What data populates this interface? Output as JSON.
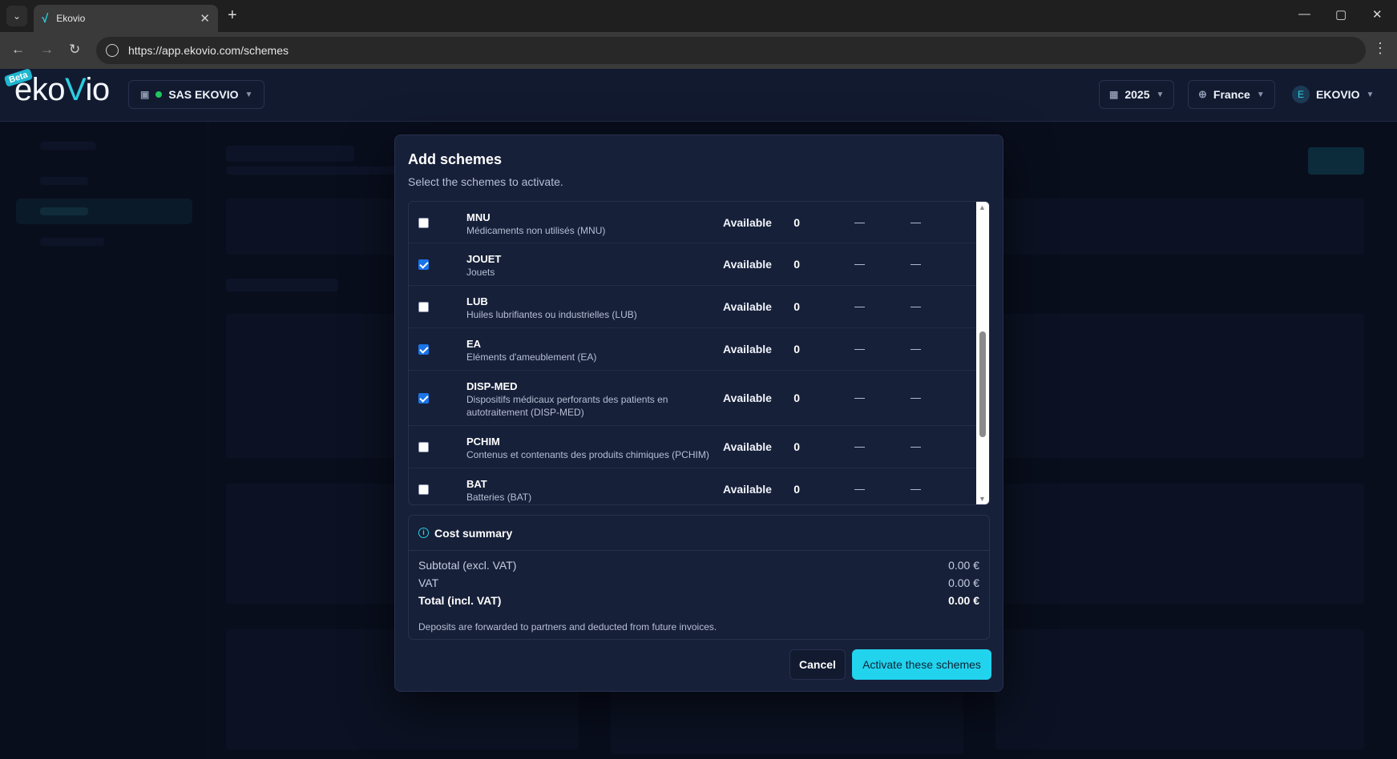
{
  "browser": {
    "tab_title": "Ekovio",
    "url": "https://app.ekovio.com/schemes"
  },
  "header": {
    "beta": "Beta",
    "logo_prefix": "eko",
    "logo_v": "V",
    "logo_suffix": "io",
    "org_name": "SAS EKOVIO",
    "year": "2025",
    "country": "France",
    "user_initial": "E",
    "user_name": "EKOVIO"
  },
  "modal": {
    "title": "Add schemes",
    "subtitle": "Select the schemes to activate.",
    "schemes": [
      {
        "code": "MNU",
        "desc": "Médicaments non utilisés (MNU)",
        "status": "Available",
        "qty": "0",
        "c1": "—",
        "c2": "—",
        "checked": false
      },
      {
        "code": "JOUET",
        "desc": "Jouets",
        "status": "Available",
        "qty": "0",
        "c1": "—",
        "c2": "—",
        "checked": true
      },
      {
        "code": "LUB",
        "desc": "Huiles lubrifiantes ou industrielles (LUB)",
        "status": "Available",
        "qty": "0",
        "c1": "—",
        "c2": "—",
        "checked": false
      },
      {
        "code": "EA",
        "desc": "Eléments d'ameublement (EA)",
        "status": "Available",
        "qty": "0",
        "c1": "—",
        "c2": "—",
        "checked": true
      },
      {
        "code": "DISP-MED",
        "desc": "Dispositifs médicaux perforants des patients en autotraitement (DISP-MED)",
        "status": "Available",
        "qty": "0",
        "c1": "—",
        "c2": "—",
        "checked": true
      },
      {
        "code": "PCHIM",
        "desc": "Contenus et contenants des produits chimiques (PCHIM)",
        "status": "Available",
        "qty": "0",
        "c1": "—",
        "c2": "—",
        "checked": false
      },
      {
        "code": "BAT",
        "desc": "Batteries (BAT)",
        "status": "Available",
        "qty": "0",
        "c1": "—",
        "c2": "—",
        "checked": false
      }
    ],
    "cost": {
      "title": "Cost summary",
      "subtotal_label": "Subtotal (excl. VAT)",
      "subtotal_value": "0.00 €",
      "vat_label": "VAT",
      "vat_value": "0.00 €",
      "total_label": "Total (incl. VAT)",
      "total_value": "0.00 €",
      "note": "Deposits are forwarded to partners and deducted from future invoices."
    },
    "cancel_label": "Cancel",
    "activate_label": "Activate these schemes"
  },
  "colors": {
    "accent": "#22d3ee",
    "background": "#0e1528",
    "modal": "#172039",
    "checkbox_checked": "#1a73e8"
  }
}
